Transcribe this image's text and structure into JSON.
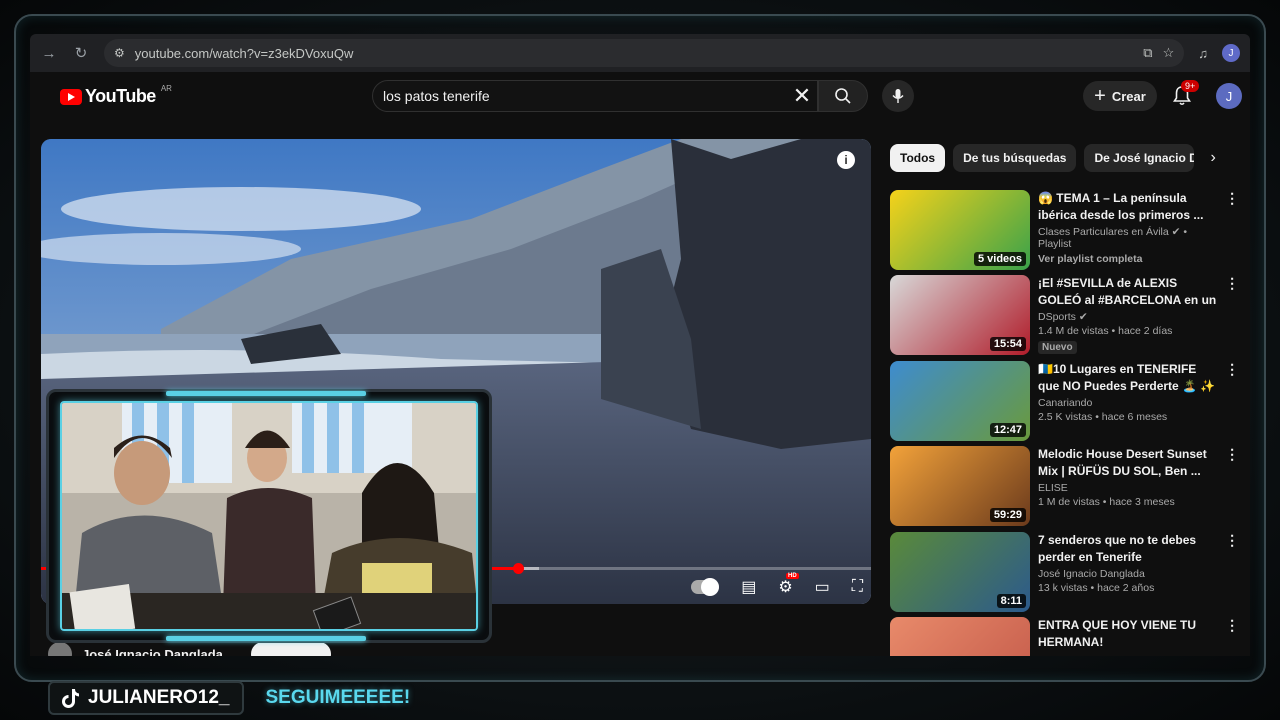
{
  "browser": {
    "url": "youtube.com/watch?v=z3ekDVoxuQw",
    "profile_initial": "J"
  },
  "youtube": {
    "logo_text": "YouTube",
    "country": "AR",
    "search_query": "los patos tenerife",
    "create_label": "Crear",
    "notifications": "9+",
    "avatar_initial": "J"
  },
  "video": {
    "progress_percent": 57.5,
    "loaded_percent": 60
  },
  "below": {
    "channel_name": "José Ignacio Danglada"
  },
  "chips": [
    "Todos",
    "De tus búsquedas",
    "De José Ignacio Danglada"
  ],
  "recommendations": [
    {
      "title": "😱 TEMA 1 – La península ibérica desde los primeros ...",
      "channel": "Clases Particulares en Ávila",
      "verified": true,
      "stats": "• Playlist",
      "extra": "Ver playlist completa",
      "duration": "5 videos",
      "badge": "",
      "thumb_colors": [
        "#f5d21a",
        "#3aa24a"
      ]
    },
    {
      "title": "¡El #SEVILLA de ALEXIS GOLEÓ al #BARCELONA en un ...",
      "channel": "DSports",
      "verified": true,
      "stats": "1.4 M de vistas • hace 2 días",
      "extra": "",
      "duration": "15:54",
      "badge": "Nuevo",
      "thumb_colors": [
        "#d8d8d8",
        "#b01c2a"
      ]
    },
    {
      "title": "🇮🇨10 Lugares en TENERIFE que NO Puedes Perderte 🏝️ ✨ ...",
      "channel": "Canariando",
      "verified": false,
      "stats": "2.5 K vistas • hace 6 meses",
      "extra": "",
      "duration": "12:47",
      "badge": "",
      "thumb_colors": [
        "#3e8ccf",
        "#6a9a3c"
      ]
    },
    {
      "title": "Melodic House Desert Sunset Mix | RÜFÜS DU SOL, Ben ...",
      "channel": "ELISE",
      "verified": false,
      "stats": "1 M de vistas • hace 3 meses",
      "extra": "",
      "duration": "59:29",
      "badge": "",
      "thumb_colors": [
        "#f2a23a",
        "#6b3a1c"
      ]
    },
    {
      "title": "7 senderos que no te debes perder en Tenerife",
      "channel": "José Ignacio Danglada",
      "verified": false,
      "stats": "13 k vistas • hace 2 años",
      "extra": "",
      "duration": "8:11",
      "badge": "",
      "thumb_colors": [
        "#5a8a3a",
        "#2c5a8c"
      ]
    },
    {
      "title": "ENTRA QUE HOY VIENE TU HERMANA!",
      "channel": "",
      "verified": false,
      "stats": "",
      "extra": "",
      "duration": "",
      "badge": "",
      "thumb_colors": [
        "#e88a6a",
        "#c45a4a"
      ]
    }
  ],
  "overlay": {
    "tiktok_handle": "JULIANERO12_",
    "call_to_action": "SEGUIMEEEEE!"
  }
}
